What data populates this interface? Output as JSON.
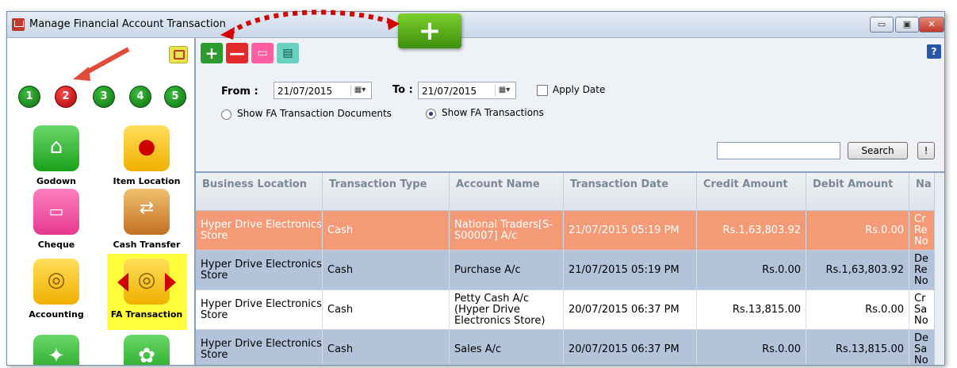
{
  "window": {
    "title": "Manage Financial Account Transaction",
    "controls": {
      "minimize": "▭",
      "restore": "▣",
      "close": "✕"
    }
  },
  "sidebar": {
    "steps": [
      "1",
      "2",
      "3",
      "4",
      "5"
    ],
    "active_step": "2",
    "tiles": [
      {
        "label": "Godown",
        "icon": "house-icon"
      },
      {
        "label": "Item Location",
        "icon": "map-pin-icon"
      },
      {
        "label": "Cheque",
        "icon": "cheque-icon"
      },
      {
        "label": "Cash Transfer",
        "icon": "cash-transfer-icon"
      },
      {
        "label": "Accounting",
        "icon": "coins-icon"
      },
      {
        "label": "FA Transaction",
        "icon": "coins-exchange-icon",
        "selected": true
      }
    ]
  },
  "toolbar": {
    "add": "+",
    "remove": "—",
    "help": "?"
  },
  "filters": {
    "from_label": "From :",
    "from_value": "21/07/2015",
    "to_label": "To :",
    "to_value": "21/07/2015",
    "apply_date": "Apply Date",
    "radio_documents": "Show FA Transaction Documents",
    "radio_transactions": "Show FA Transactions",
    "search_button": "Search",
    "extra_button": "!"
  },
  "grid": {
    "columns": [
      "Business Location",
      "Transaction Type",
      "Account Name",
      "Transaction Date",
      "Credit Amount",
      "Debit Amount",
      "Na"
    ],
    "rows": [
      {
        "location": "Hyper Drive Electronics Store",
        "type": "Cash",
        "account": "National Traders[S-S00007] A/c",
        "date": "21/07/2015 05:19 PM",
        "credit": "Rs.1,63,803.92",
        "debit": "Rs.0.00",
        "narration": "Cr Re No",
        "style": "selected"
      },
      {
        "location": "Hyper Drive Electronics Store",
        "type": "Cash",
        "account": "Purchase A/c",
        "date": "21/07/2015 05:19 PM",
        "credit": "Rs.0.00",
        "debit": "Rs.1,63,803.92",
        "narration": "De Re No",
        "style": "alt"
      },
      {
        "location": "Hyper Drive Electronics Store",
        "type": "Cash",
        "account": "Petty Cash A/c (Hyper Drive Electronics Store)",
        "date": "20/07/2015 06:37 PM",
        "credit": "Rs.13,815.00",
        "debit": "Rs.0.00",
        "narration": "Cr Sa No",
        "style": "normal"
      },
      {
        "location": "Hyper Drive Electronics Store",
        "type": "Cash",
        "account": "Sales A/c",
        "date": "20/07/2015 06:37 PM",
        "credit": "Rs.0.00",
        "debit": "Rs.13,815.00",
        "narration": "De Sa No",
        "style": "alt"
      }
    ]
  },
  "callout": {
    "symbol": "+"
  },
  "colors": {
    "selected_row": "#f59a76",
    "alt_row": "#b3c3da",
    "normal_row": "#ffffff",
    "annotation_red": "#d40000"
  }
}
